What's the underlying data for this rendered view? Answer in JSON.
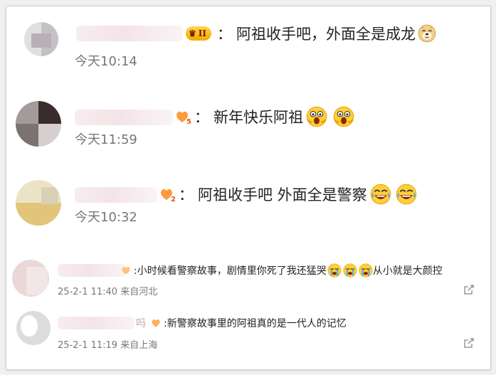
{
  "comments": [
    {
      "separator": "：",
      "text": "阿祖收手吧，外面全是成龙",
      "time": "今天10:14",
      "vip_level": "II",
      "emoji_names": [
        "doge-emoji"
      ]
    },
    {
      "separator": "：",
      "text": "新年快乐阿祖",
      "time": "今天11:59",
      "badge_level": "5",
      "emoji_names": [
        "scared-emoji",
        "scared-emoji"
      ]
    },
    {
      "separator": "：",
      "text": "阿祖收手吧 外面全是警察",
      "time": "今天10:32",
      "badge_level": "2",
      "emoji_names": [
        "laugh-cry-emoji",
        "laugh-cry-emoji"
      ]
    }
  ],
  "replies": [
    {
      "text_before": ":小时候看警察故事，剧情里你死了我还猛哭",
      "text_after": "从小就是大颜控",
      "meta": "25-2-1 11:40 来自河北",
      "emoji_names": [
        "crying-emoji",
        "crying-emoji",
        "crying-emoji"
      ]
    },
    {
      "name_tail": "吗",
      "text": ":新警察故事里的阿祖真的是一代人的记忆",
      "meta": "25-2-1 11:19 来自上海"
    }
  ],
  "colors": {
    "background": "#ffffff",
    "text": "#222222",
    "muted": "#777777",
    "badge_orange": "#e05a1b",
    "vip_gold": "#f2a900"
  }
}
